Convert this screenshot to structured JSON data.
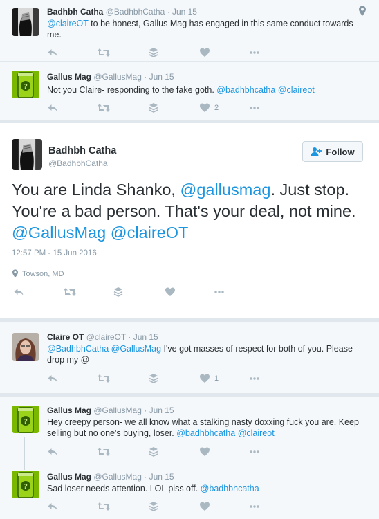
{
  "tweets": [
    {
      "name": "Badhbh Catha",
      "handle": "@BadhbhCatha",
      "time": "· Jun 15",
      "text_parts": [
        "@claireOT",
        " to be honest, Gallus Mag has engaged in this same conduct towards me."
      ],
      "like_count": ""
    },
    {
      "name": "Gallus Mag",
      "handle": "@GallusMag",
      "time": "· Jun 15",
      "text_parts": [
        "Not you Claire- responding to the fake goth. ",
        "@badhbhcatha",
        " ",
        "@claireot"
      ],
      "like_count": "2"
    },
    {
      "name": "Claire OT",
      "handle": "@claireOT",
      "time": "· Jun 15",
      "text_parts": [
        "@BadhbhCatha",
        " ",
        "@GallusMag",
        " I've got masses of respect for both of you. Please drop my @"
      ],
      "like_count": "1"
    },
    {
      "name": "Gallus Mag",
      "handle": "@GallusMag",
      "time": "· Jun 15",
      "text_parts": [
        "Hey creepy person- we all know what a stalking nasty doxxing fuck you are. Keep selling but no one's buying, loser. ",
        "@badhbhcatha",
        " ",
        "@claireot"
      ],
      "like_count": ""
    },
    {
      "name": "Gallus Mag",
      "handle": "@GallusMag",
      "time": "· Jun 15",
      "text_parts": [
        "Sad loser needs attention. LOL piss off. ",
        "@badhbhcatha"
      ],
      "like_count": ""
    }
  ],
  "main_tweet": {
    "name": "Badhbh Catha",
    "handle": "@BadhbhCatha",
    "follow_label": "Follow",
    "text_parts": [
      "You are Linda Shanko, ",
      "@gallusmag",
      ". Just stop. You're a bad person. That's your deal, not mine. ",
      "@GallusMag",
      " ",
      "@claireOT"
    ],
    "timestamp": "12:57 PM - 15 Jun 2016",
    "location": "Towson, MD"
  },
  "icons": [
    "reply-icon",
    "retweet-icon",
    "layers-icon",
    "heart-icon",
    "more-icon",
    "location-pin-icon",
    "follow-user-icon"
  ],
  "colors": {
    "link": "#1b95e0",
    "muted": "#8899a6",
    "icon": "#aab8c2",
    "context_bg": "#f5f8fa",
    "divider": "#e1e8ed"
  }
}
